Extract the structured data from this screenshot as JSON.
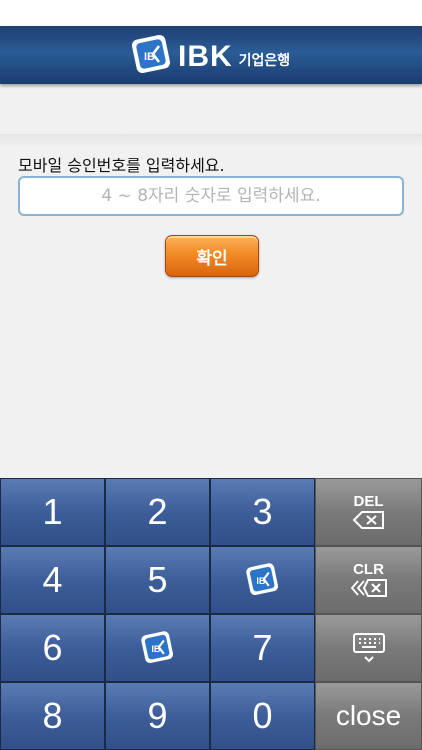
{
  "header": {
    "logo_text": "IBK",
    "logo_sub": "기업은행"
  },
  "form": {
    "prompt": "모바일 승인번호를 입력하세요.",
    "input_placeholder": "4 ~ 8자리 숫자로 입력하세요.",
    "input_value": "",
    "confirm_label": "확인"
  },
  "keypad": {
    "keys": {
      "k1": "1",
      "k2": "2",
      "k3": "3",
      "k4": "4",
      "k5": "5",
      "k6": "6",
      "k7": "7",
      "k8": "8",
      "k9": "9",
      "k0": "0"
    },
    "del_label": "DEL",
    "clr_label": "CLR",
    "close_label": "close"
  },
  "colors": {
    "header": "#2b5c96",
    "key_blue": "#3d5e99",
    "key_gray": "#7a7a7a",
    "confirm": "#f28a26"
  },
  "icons": [
    "ibk-logo-icon",
    "backspace-icon",
    "clear-icon",
    "keyboard-hide-icon"
  ]
}
